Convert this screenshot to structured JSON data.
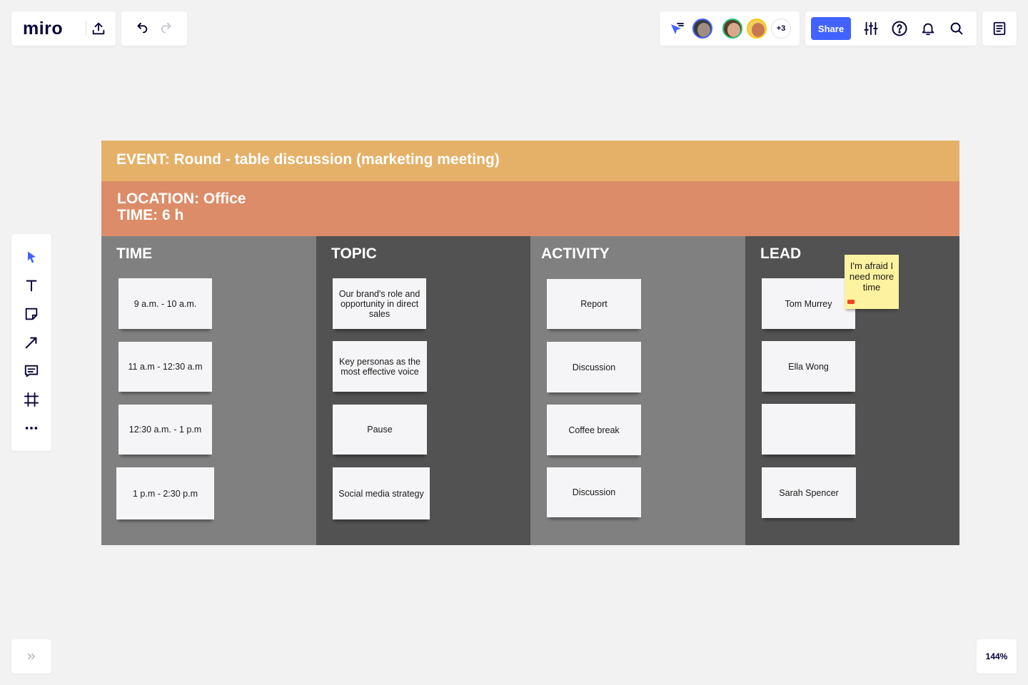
{
  "app": {
    "logo": "miro"
  },
  "toolbar": {
    "share_label": "Share",
    "more_collaborators": "+3"
  },
  "zoom": {
    "level": "144%"
  },
  "icons": {
    "upload": "upload-icon",
    "undo": "undo-icon",
    "redo": "redo-icon",
    "cursor_follow": "cursor-follow-icon",
    "settings": "sliders-icon",
    "help": "help-icon",
    "notifications": "bell-icon",
    "search": "search-icon",
    "notes": "notes-icon",
    "select": "cursor-icon",
    "text": "text-icon",
    "sticky": "sticky-note-icon",
    "arrow": "arrow-icon",
    "comment": "comment-icon",
    "frame": "frame-icon",
    "more": "more-icon",
    "expand": "chevron-double-right-icon"
  },
  "colors": {
    "accent": "#4262ff",
    "event_bar": "#e5b168",
    "location_bar": "#dc8c68",
    "column_light": "#808080",
    "column_dark": "#525252",
    "comment_sticky": "#fdf29f"
  },
  "board": {
    "event_title": "EVENT: Round - table discussion (marketing meeting)",
    "location": "LOCATION: Office",
    "time": "TIME: 6 h",
    "columns": {
      "time": {
        "header": "TIME",
        "notes": [
          "9 a.m. - 10 a.m.",
          "11 a.m - 12:30 a.m",
          "12:30 a.m. - 1 p.m",
          "1 p.m - 2:30 p.m"
        ]
      },
      "topic": {
        "header": "TOPIC",
        "notes": [
          "Our brand's role and opportunity in  direct sales",
          "Key personas as the most effective voice",
          "Pause",
          "Social media strategy"
        ]
      },
      "activity": {
        "header": "ACTIVITY",
        "notes": [
          "Report",
          "Discussion",
          "Coffee break",
          "Discussion"
        ]
      },
      "lead": {
        "header": "LEAD",
        "notes": [
          "Tom Murrey",
          "Ella Wong",
          "",
          "Sarah Spencer"
        ]
      }
    },
    "comment_note": "I'm afraid I need more time"
  }
}
